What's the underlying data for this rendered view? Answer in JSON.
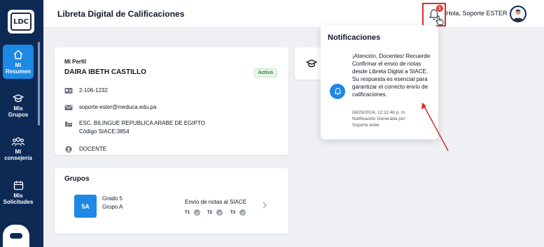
{
  "sidebar": {
    "logo_text": "LDC",
    "items": [
      {
        "label": "Mi\nResumen",
        "l1": "Mi",
        "l2": "Resumen",
        "icon": "home-icon",
        "active": true
      },
      {
        "l1": "Mis",
        "l2": "Grupos",
        "icon": "graduation-cap-icon",
        "active": false
      },
      {
        "l1": "Mi",
        "l2": "consejería",
        "icon": "users-icon",
        "active": false
      },
      {
        "l1": "Mis",
        "l2": "Solicitudes",
        "icon": "calendar-icon",
        "active": false
      }
    ]
  },
  "header": {
    "title": "Libreta Digital de Calificaciones",
    "notification_count": "1",
    "greeting": "Hola, Soporte ESTER"
  },
  "profile": {
    "section_title": "Mi Perfil",
    "name": "DAIRA IBETH CASTILLO",
    "status": "Activo",
    "id_number": "2-106-1232",
    "email": "soporte-ester@meduca.edu.pa",
    "school": "ESC. BILINGUE REPUBLICA ARABE DE EGIPTO",
    "siace_code": "Código SIACE:3854",
    "role": "DOCENTE"
  },
  "groups": {
    "section_title": "Grupos",
    "items": [
      {
        "chip": "5A",
        "grade": "Grado 5",
        "group": "Grupo A",
        "send_label": "Envío de notas al SIACE",
        "terms": [
          "T1",
          "T2",
          "T3"
        ]
      }
    ]
  },
  "notifications": {
    "title": "Notificaciones",
    "message": "¡Atención, Docentes! Recuerde Confirmar el envío de notas desde Libreta Digital a SIACE. Su respuesta es esencial para garantizar el correcto envío de calificaciones.",
    "timestamp": "08/29/2024, 12:11:46 p. m.",
    "generated_by_l1": "Notificación Generada por:",
    "generated_by_l2": "Soporte ester"
  },
  "colors": {
    "sidebar_bg": "#0d2a55",
    "accent": "#1e88e5",
    "highlight": "#d32f2f",
    "status_active": "#2e7d32"
  }
}
